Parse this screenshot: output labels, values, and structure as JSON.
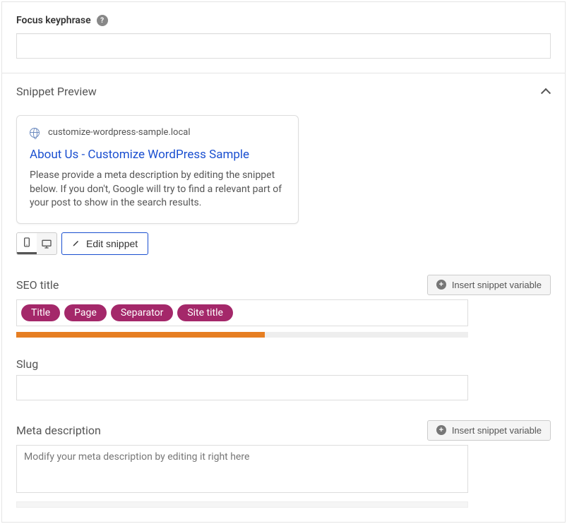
{
  "focus": {
    "label": "Focus keyphrase",
    "value": ""
  },
  "snippet": {
    "title": "Snippet Preview",
    "site": "customize-wordpress-sample.local",
    "page_title": "About Us - Customize WordPress Sample",
    "description": "Please provide a meta description by editing the snippet below. If you don't, Google will try to find a relevant part of your post to show in the search results.",
    "edit_label": "Edit snippet"
  },
  "seo_title": {
    "label": "SEO title",
    "insert_label": "Insert snippet variable",
    "pills": {
      "a": "Title",
      "b": "Page",
      "c": "Separator",
      "d": "Site title"
    },
    "progress_percent": 55
  },
  "slug": {
    "label": "Slug",
    "value": ""
  },
  "meta": {
    "label": "Meta description",
    "insert_label": "Insert snippet variable",
    "placeholder": "Modify your meta description by editing it right here",
    "value": ""
  }
}
